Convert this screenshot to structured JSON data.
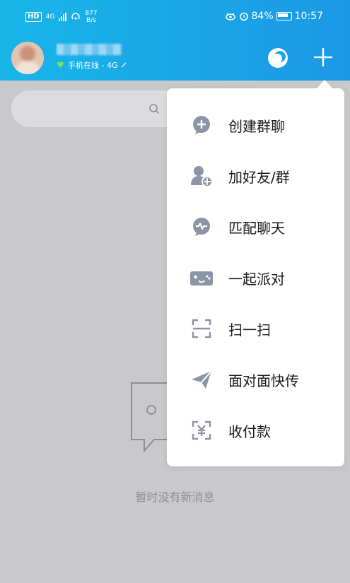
{
  "status_bar": {
    "hd": "HD",
    "network": "4G",
    "speed_value": "877",
    "speed_unit": "B/s",
    "battery": "84%",
    "time": "10:57"
  },
  "header": {
    "online_status": "手机在线 - 4G"
  },
  "menu": {
    "items": [
      {
        "label": "创建群聊",
        "icon": "create-group-chat-icon"
      },
      {
        "label": "加好友/群",
        "icon": "add-friend-icon"
      },
      {
        "label": "匹配聊天",
        "icon": "match-chat-icon"
      },
      {
        "label": "一起派对",
        "icon": "party-icon"
      },
      {
        "label": "扫一扫",
        "icon": "scan-icon"
      },
      {
        "label": "面对面快传",
        "icon": "send-icon"
      },
      {
        "label": "收付款",
        "icon": "payment-icon"
      }
    ]
  },
  "empty_state": {
    "text": "暂时没有新消息"
  },
  "colors": {
    "header_start": "#19b6e8",
    "header_end": "#1a98e6",
    "icon_gray": "#8c95a6"
  }
}
